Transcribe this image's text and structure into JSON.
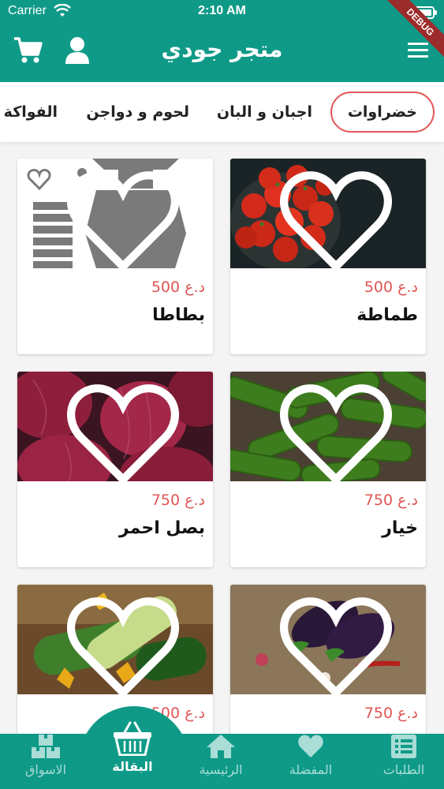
{
  "status": {
    "carrier": "Carrier",
    "time": "2:10 AM"
  },
  "debug_banner": "DEBUG",
  "header": {
    "title": "متجر جودي",
    "icons": [
      "cart-icon",
      "user-icon",
      "menu-icon"
    ]
  },
  "categories": [
    {
      "label": "خضراوات",
      "active": true
    },
    {
      "label": "اجبان و البان",
      "active": false
    },
    {
      "label": "لحوم و دواجن",
      "active": false
    },
    {
      "label": "الفواكة",
      "active": false
    }
  ],
  "products": [
    {
      "name": "طماطة",
      "price": "500 د.ع"
    },
    {
      "name": "بطاطا",
      "price": "500 د.ع"
    },
    {
      "name": "خيار",
      "price": "750 د.ع"
    },
    {
      "name": "بصل احمر",
      "price": "750 د.ع"
    },
    {
      "name": "",
      "price": "750 د.ع"
    },
    {
      "name": "",
      "price": "500 د.ع"
    }
  ],
  "bottom_nav": [
    {
      "label": "الطلبات",
      "icon": "list-icon",
      "active": false
    },
    {
      "label": "المفضلة",
      "icon": "heart-icon",
      "active": false
    },
    {
      "label": "الرئيسية",
      "icon": "home-icon",
      "active": false
    },
    {
      "label": "البقالة",
      "icon": "basket-icon",
      "active": true
    },
    {
      "label": "الاسواق",
      "icon": "boxes-icon",
      "active": false
    }
  ],
  "colors": {
    "primary": "#0f9a88",
    "accent": "#e05555",
    "inactive_nav": "#a9ddd6"
  }
}
